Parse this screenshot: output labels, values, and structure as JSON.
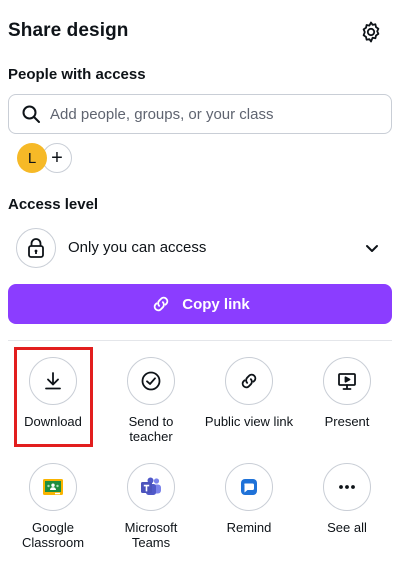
{
  "header": {
    "title": "Share design",
    "settings_icon": "gear-icon"
  },
  "people": {
    "label": "People with access",
    "search_placeholder": "Add people, groups, or your class",
    "search_value": "",
    "avatar_initial": "L",
    "avatar_color": "#f6b927",
    "add_label": "+"
  },
  "access": {
    "label": "Access level",
    "value": "Only you can access",
    "icon": "lock-icon"
  },
  "copy_link": {
    "label": "Copy link",
    "color": "#8b3dff",
    "icon": "link-icon"
  },
  "share_options": [
    {
      "label": "Download",
      "icon": "download-icon"
    },
    {
      "label": "Send to teacher",
      "icon": "check-circle-icon"
    },
    {
      "label": "Public view link",
      "icon": "link-icon"
    },
    {
      "label": "Present",
      "icon": "present-icon"
    },
    {
      "label": "Google Classroom",
      "icon": "google-classroom-icon"
    },
    {
      "label": "Microsoft Teams",
      "icon": "microsoft-teams-icon"
    },
    {
      "label": "Remind",
      "icon": "remind-icon"
    },
    {
      "label": "See all",
      "icon": "more-icon"
    }
  ],
  "highlight_color": "#e21e1e"
}
